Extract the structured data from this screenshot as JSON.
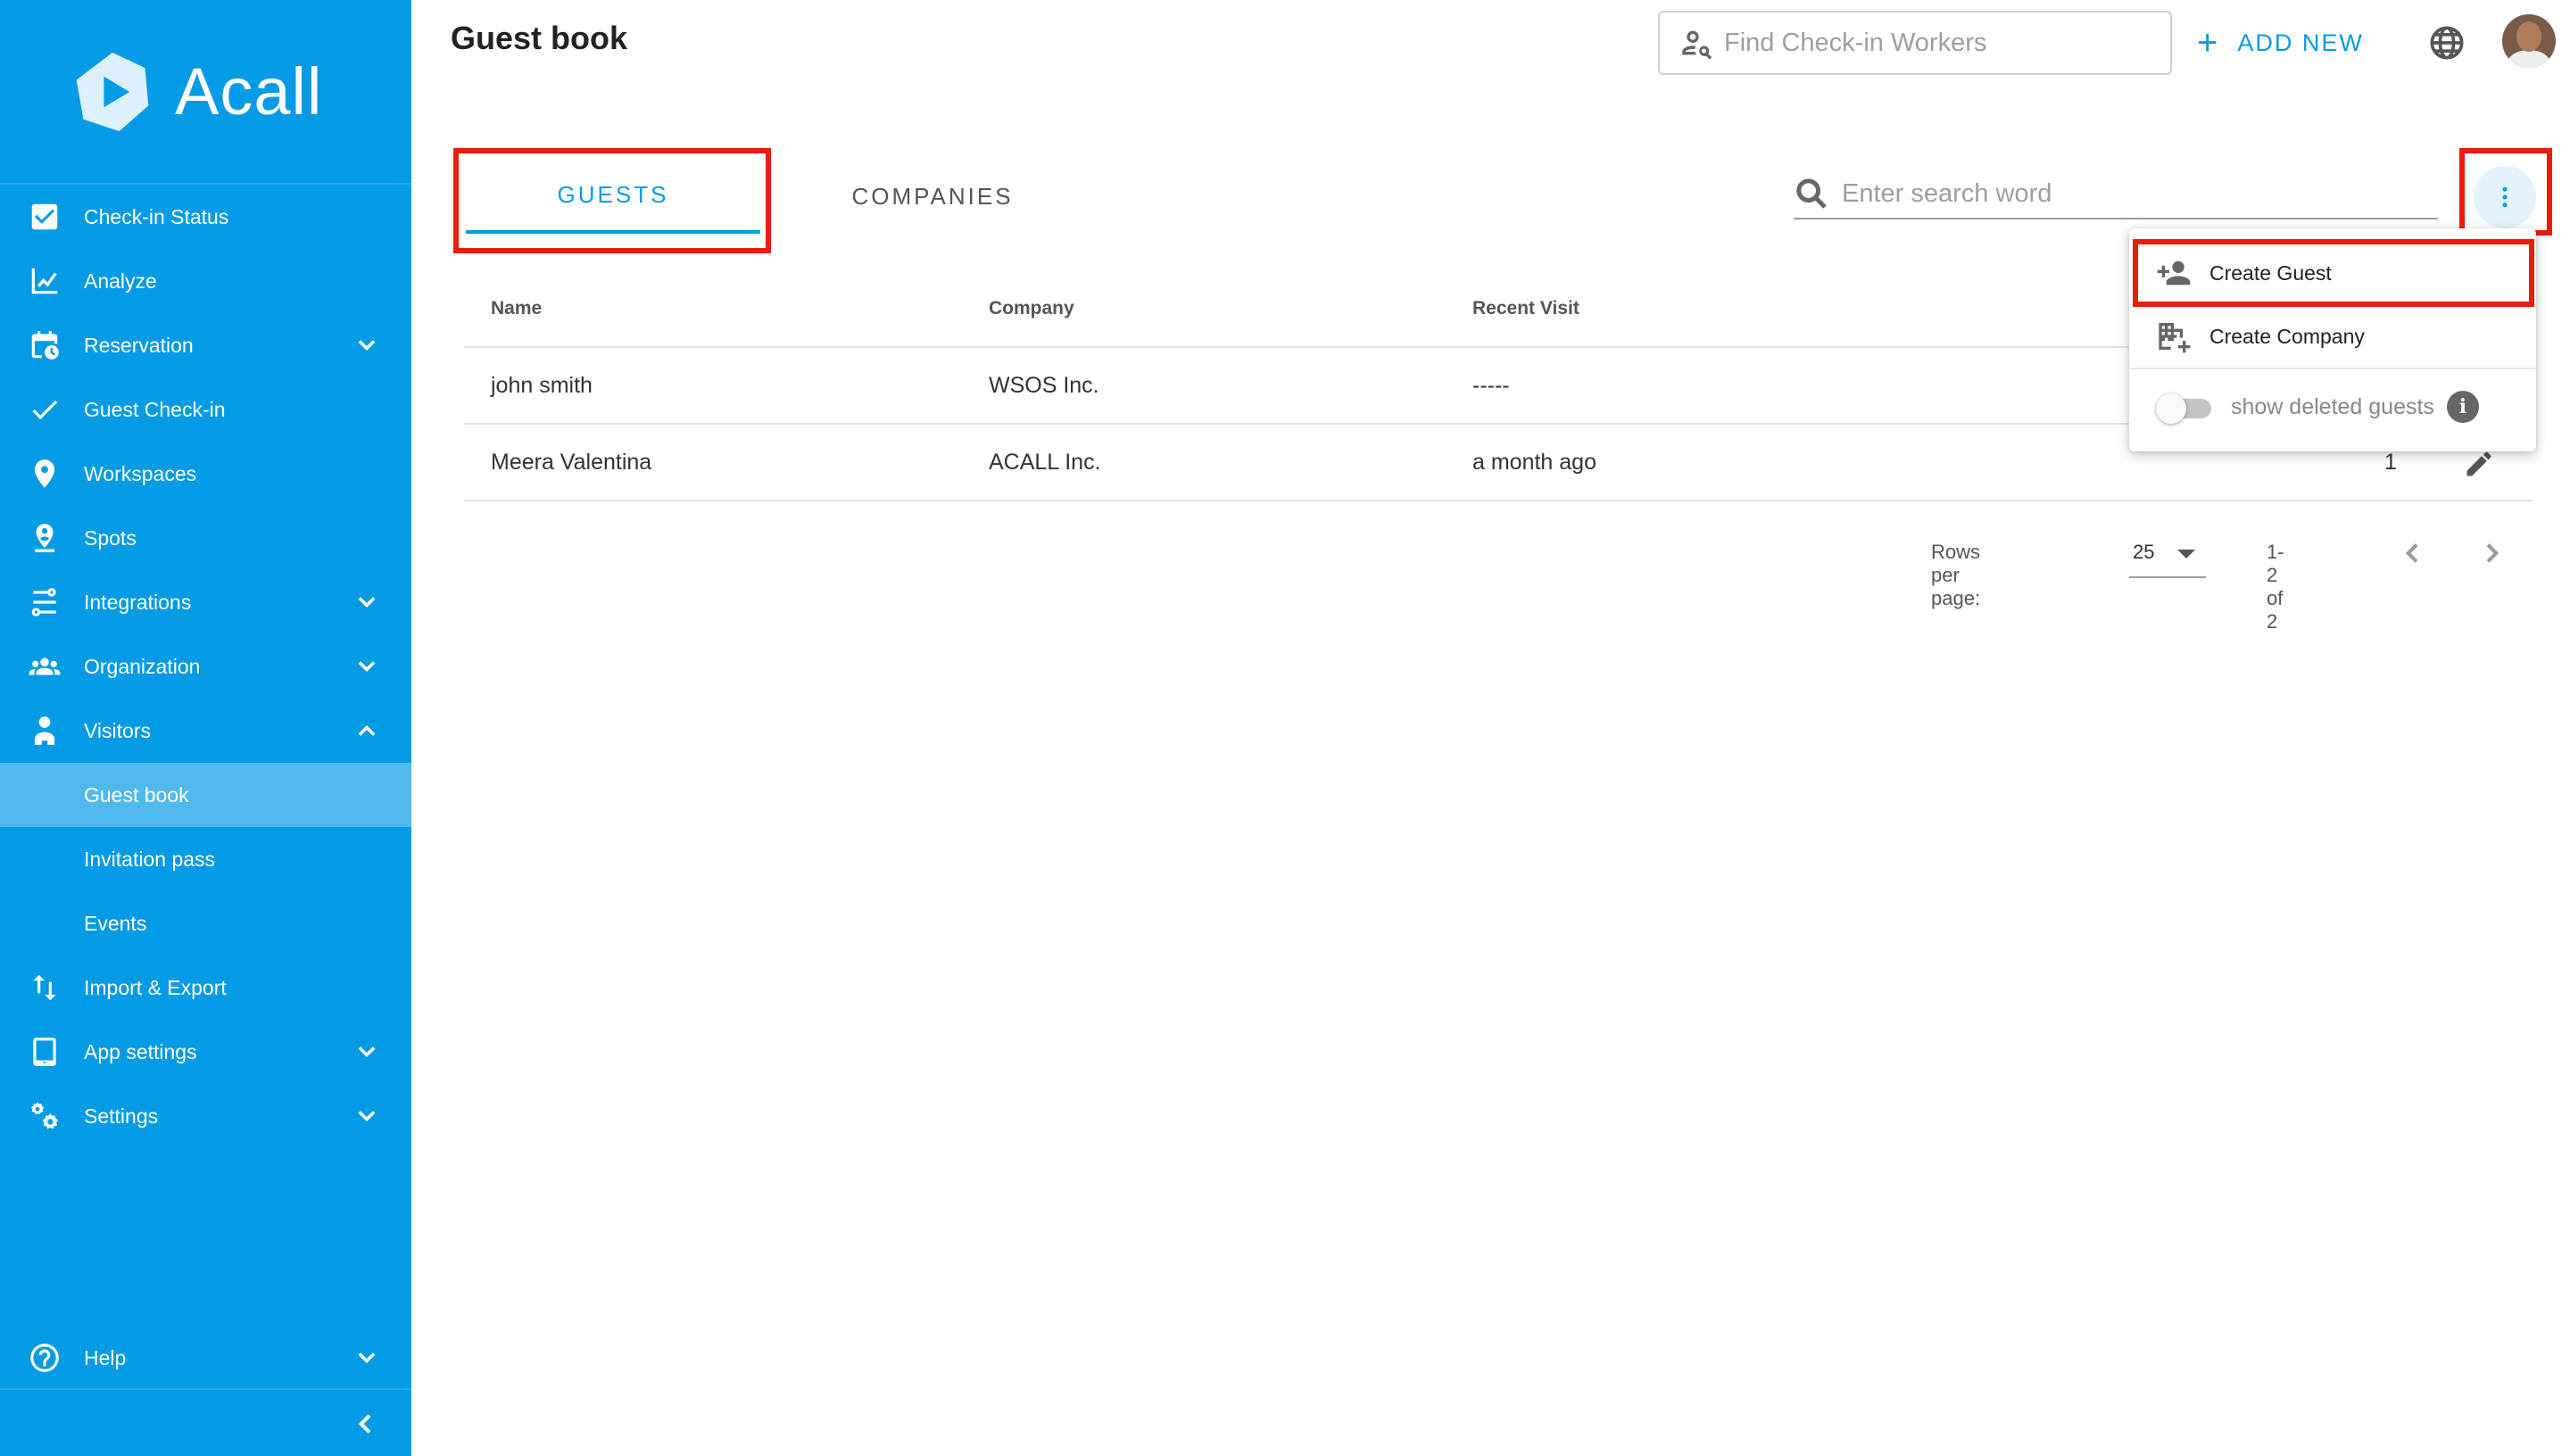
{
  "app": {
    "brand": "Acall",
    "accent": "#039be5",
    "highlight": "#e81e0c"
  },
  "sidebar": {
    "items": [
      {
        "label": "Check-in Status",
        "icon": "checkbox-icon"
      },
      {
        "label": "Analyze",
        "icon": "chart-line-icon"
      },
      {
        "label": "Reservation",
        "icon": "calendar-clock-icon",
        "expandable": true
      },
      {
        "label": "Guest Check-in",
        "icon": "check-icon"
      },
      {
        "label": "Workspaces",
        "icon": "map-pin-icon"
      },
      {
        "label": "Spots",
        "icon": "person-pin-icon"
      },
      {
        "label": "Integrations",
        "icon": "integration-icon",
        "expandable": true
      },
      {
        "label": "Organization",
        "icon": "people-icon",
        "expandable": true
      },
      {
        "label": "Visitors",
        "icon": "visitor-icon",
        "expanded": true
      }
    ],
    "visitors_sub": [
      {
        "label": "Guest book",
        "active": true
      },
      {
        "label": "Invitation pass"
      },
      {
        "label": "Events"
      }
    ],
    "items_after": [
      {
        "label": "Import & Export",
        "icon": "import-export-icon"
      },
      {
        "label": "App settings",
        "icon": "tablet-icon",
        "expandable": true
      },
      {
        "label": "Settings",
        "icon": "gears-icon",
        "expandable": true
      }
    ],
    "help": {
      "label": "Help",
      "icon": "help-circle-icon"
    }
  },
  "header": {
    "title": "Guest book",
    "find_placeholder": "Find Check-in Workers",
    "add_new": "ADD NEW"
  },
  "tabs": {
    "guests": "GUESTS",
    "companies": "COMPANIES"
  },
  "search": {
    "placeholder": "Enter search word"
  },
  "table": {
    "headers": {
      "name": "Name",
      "company": "Company",
      "recent_visit": "Recent Visit"
    },
    "rows": [
      {
        "name": "john smith",
        "company": "WSOS Inc.",
        "recent_visit": "-----",
        "count": ""
      },
      {
        "name": "Meera Valentina",
        "company": "ACALL Inc.",
        "recent_visit": "a month ago",
        "count": "1"
      }
    ]
  },
  "pagination": {
    "rows_per_page_label": "Rows per page:",
    "rows_per_page": "25",
    "range": "1-2 of 2"
  },
  "menu": {
    "create_guest": "Create Guest",
    "create_company": "Create Company",
    "show_deleted": "show deleted guests",
    "show_deleted_on": false
  }
}
